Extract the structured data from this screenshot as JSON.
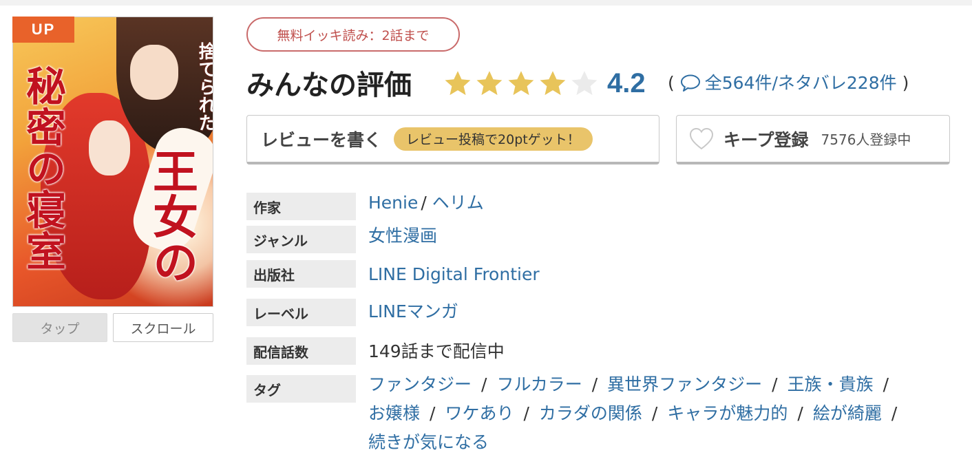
{
  "cover": {
    "badge": "UP",
    "title_lines": [
      "秘密の寝室",
      "捨てられた",
      "王女の"
    ]
  },
  "view_tabs": {
    "tap": "タップ",
    "scroll": "スクロール"
  },
  "free_read_badge": "無料イッキ読み：2話まで",
  "rating": {
    "title": "みんなの評価",
    "stars": 4,
    "max_stars": 5,
    "score": "4.2",
    "open_paren": "(",
    "counts": "全564件/ネタバレ228件",
    "close_paren": ")"
  },
  "review_button": {
    "label": "レビューを書く",
    "promo": "レビュー投稿で20ptゲット！"
  },
  "keep_button": {
    "label": "キープ登録",
    "count": "7576人登録中"
  },
  "info": {
    "author": {
      "label": "作家",
      "value1": "Henie",
      "sep": "/",
      "value2": "ヘリム"
    },
    "genre": {
      "label": "ジャンル",
      "value": "女性漫画"
    },
    "publisher": {
      "label": "出版社",
      "value": "LINE Digital Frontier"
    },
    "imprint": {
      "label": "レーベル",
      "value": "LINEマンガ"
    },
    "episodes": {
      "label": "配信話数",
      "value": "149話まで配信中"
    },
    "tags": {
      "label": "タグ",
      "items": [
        "ファンタジー",
        "フルカラー",
        "異世界ファンタジー",
        "王族・貴族",
        "お嬢様",
        "ワケあり",
        "カラダの関係",
        "キャラが魅力的",
        "絵が綺麗",
        "続きが気になる"
      ],
      "sep": "/"
    }
  },
  "colors": {
    "accent_blue": "#2f6ea3",
    "badge_orange": "#e8622a",
    "star_gold": "#e8c45a",
    "promo_yellow": "#e9c46a"
  }
}
